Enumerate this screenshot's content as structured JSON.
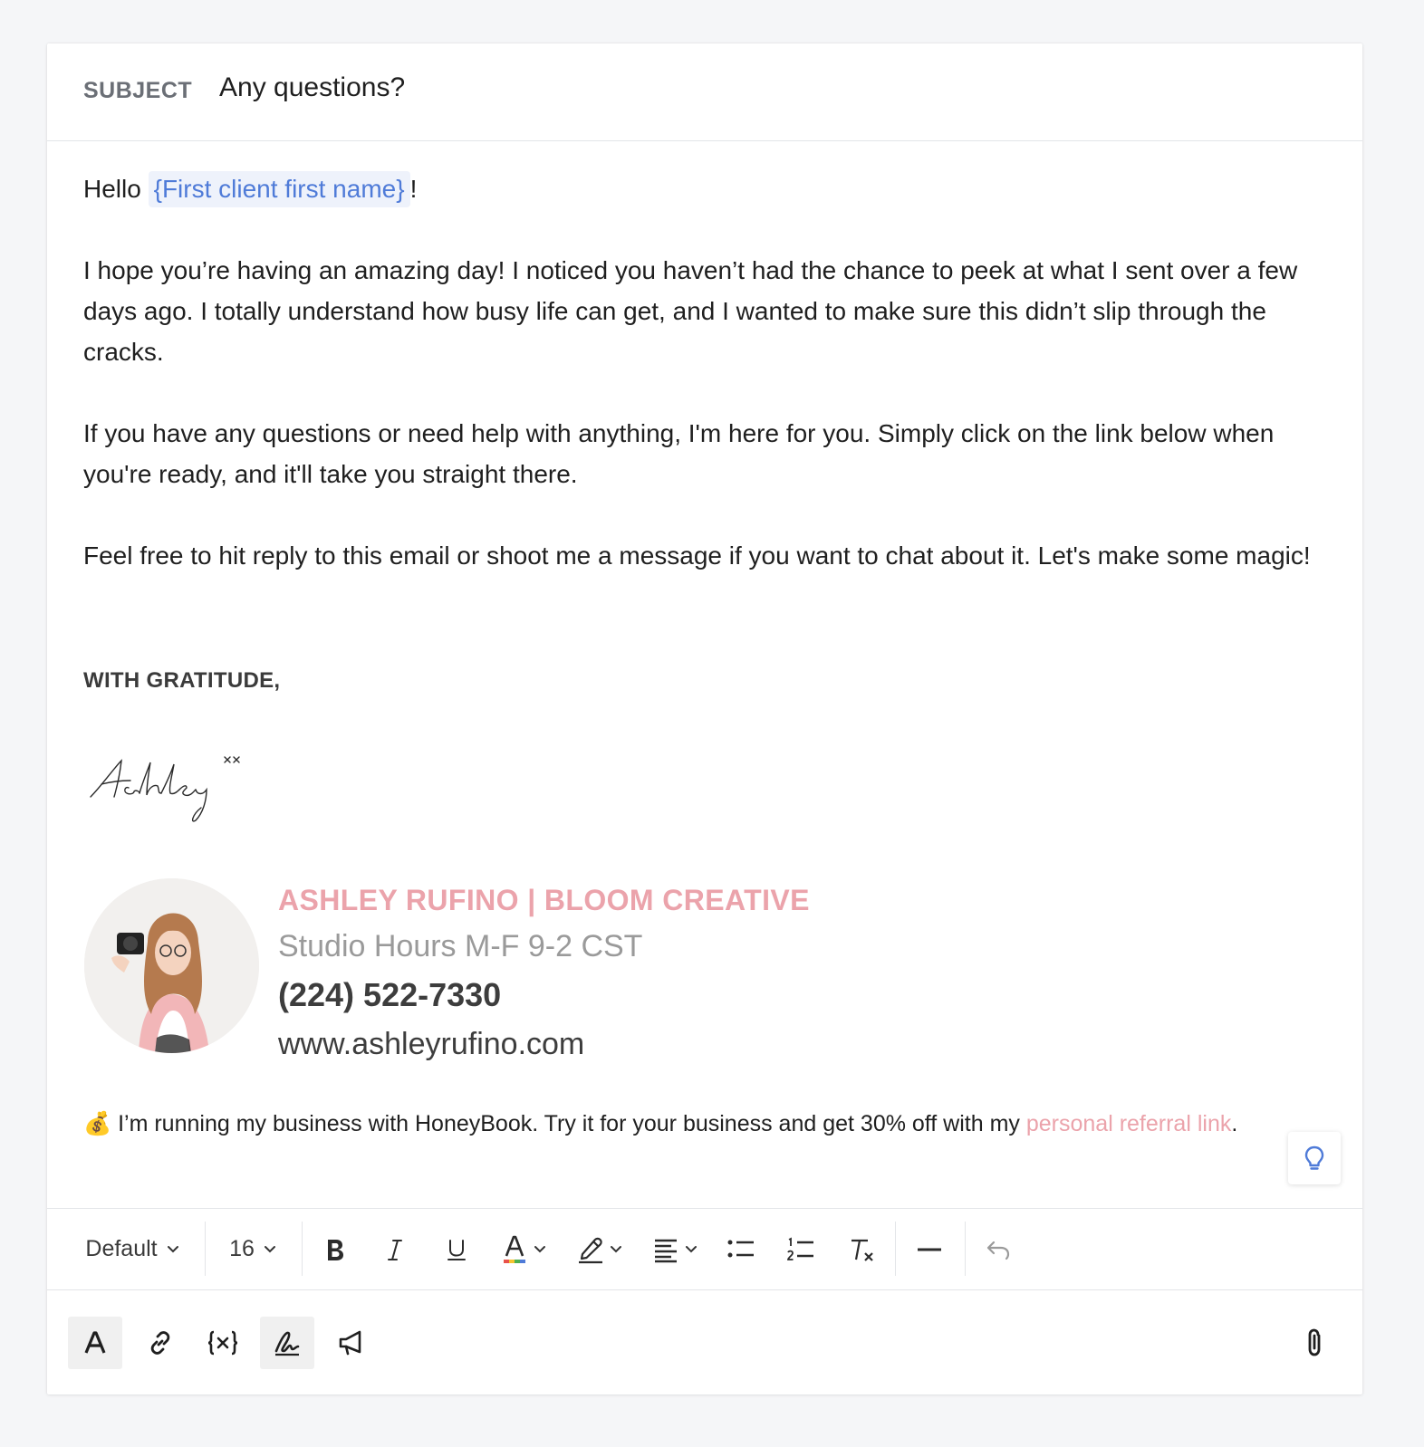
{
  "subject": {
    "label": "SUBJECT",
    "value": "Any questions?"
  },
  "email": {
    "greeting_prefix": "Hello ",
    "greeting_token": "{First client first name}",
    "greeting_suffix": "!",
    "paragraphs": [
      "I hope you’re having an amazing day! I noticed you haven’t had the chance to peek at what I sent over a few days ago. I totally understand how busy life can get, and I wanted to make sure this didn’t slip through the cracks.",
      "If you have any questions or need help with anything, I'm here for you. Simply click on the link below when you're ready, and it'll take you straight there.",
      "Feel free to hit reply to this email or shoot me a message if you want to chat about it. Let's make some magic!"
    ],
    "closing": "WITH GRATITUDE,"
  },
  "signature": {
    "handwritten": "Ashley xx",
    "name": "ASHLEY RUFINO | BLOOM CREATIVE",
    "hours": "Studio Hours M-F 9-2 CST",
    "phone": "(224) 522-7330",
    "website": "www.ashleyrufino.com"
  },
  "referral": {
    "emoji": "💰",
    "text": " I’m running my business with HoneyBook. Try it for your business and get 30% off with my ",
    "link": "personal referral link",
    "suffix": "."
  },
  "toolbar": {
    "font": "Default",
    "size": "16"
  },
  "colors": {
    "token_text": "#4f7bd8",
    "token_bg": "#eef2fb",
    "brand_pink": "#eba3ab",
    "accent_blue": "#4f7bd8"
  },
  "icons": {
    "toolbar": [
      "bold-icon",
      "italic-icon",
      "underline-icon",
      "text-color-icon",
      "highlight-icon",
      "align-icon",
      "bullet-list-icon",
      "numbered-list-icon",
      "clear-format-icon",
      "horizontal-rule-icon",
      "undo-icon"
    ],
    "bottom": [
      "text-format-icon",
      "link-icon",
      "variable-icon",
      "signature-icon",
      "megaphone-icon",
      "attachment-icon"
    ],
    "floating": "lightbulb-icon"
  }
}
